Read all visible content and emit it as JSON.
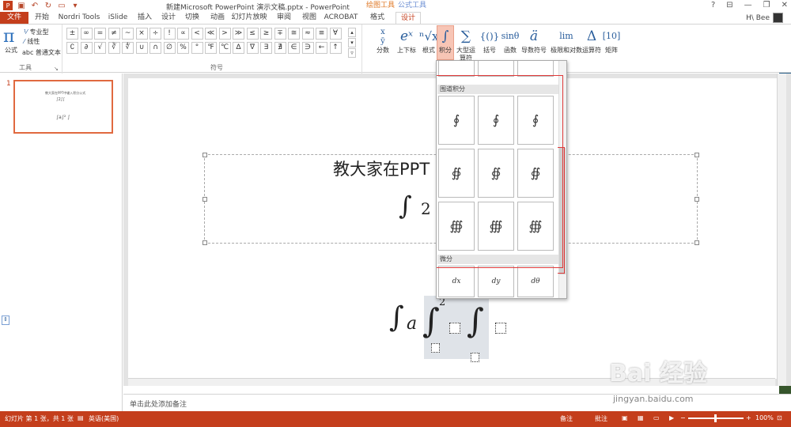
{
  "window": {
    "title": "新建Microsoft PowerPoint 演示文稿.pptx - PowerPoint",
    "context_groups": [
      {
        "label": "绘图工具",
        "color": "#e07b2a"
      },
      {
        "label": "公式工具",
        "color": "#6d8fd3"
      }
    ],
    "controls": [
      "?",
      "⊟",
      "—",
      "❐",
      "✕"
    ],
    "user": "H\\ Bee"
  },
  "tabs": [
    "文件",
    "开始",
    "Nordri Tools",
    "iSlide",
    "插入",
    "设计",
    "切换",
    "动画",
    "幻灯片放映",
    "审阅",
    "视图",
    "ACROBAT",
    "格式",
    "设计"
  ],
  "ribbon": {
    "tools": {
      "formula_label": "公式",
      "professional": "专业型",
      "linear": "线性",
      "plain_text": "abc 普通文本",
      "group_label": "工具"
    },
    "symbols": {
      "row1": [
        "±",
        "∞",
        "=",
        "≠",
        "~",
        "×",
        "÷",
        "!",
        "∝",
        "<",
        "≪",
        ">",
        "≫",
        "≤",
        "≥",
        "∓",
        "≅",
        "≈",
        "≡",
        "∀"
      ],
      "row2": [
        "∁",
        "∂",
        "√",
        "∛",
        "∜",
        "∪",
        "∩",
        "∅",
        "%",
        "°",
        "℉",
        "℃",
        "∆",
        "∇",
        "∃",
        "∄",
        "∈",
        "∋",
        "←",
        "↑"
      ],
      "group_label": "符号"
    },
    "structures": [
      {
        "icon": "x/y",
        "label": "分数"
      },
      {
        "icon": "eˣ",
        "label": "上下标"
      },
      {
        "icon": "ⁿ√x",
        "label": "根式"
      },
      {
        "icon": "∫",
        "label": "积分"
      },
      {
        "icon": "∑",
        "label": "大型运算符"
      },
      {
        "icon": "{()}",
        "label": "括号"
      },
      {
        "icon": "sinθ",
        "label": "函数"
      },
      {
        "icon": "ä",
        "label": "导数符号"
      },
      {
        "icon": "lim",
        "label": "极限和对数"
      },
      {
        "icon": "Δ",
        "label": "运算符"
      },
      {
        "icon": "[10]",
        "label": "矩阵"
      }
    ]
  },
  "slide_pane": {
    "slide_number": "1",
    "thumb_title": "教大家在PPT中输入积分公式",
    "thumb_eq1": "∫2∫∫",
    "thumb_eq2": "∫a∫² ∫"
  },
  "slide": {
    "title": "教大家在PPT",
    "eq1": "∫",
    "eq1_sub": "2",
    "eq2_a": "∫",
    "eq2_b": "a",
    "eq2_c": "∫",
    "eq2_sup": "2",
    "eq2_d": "∫"
  },
  "gallery": {
    "section1": "围道积分",
    "section2": "微分",
    "contour_items": [
      "∮",
      "∮",
      "∮",
      "∯",
      "∯",
      "∯",
      "∰",
      "∰",
      "∰"
    ],
    "diff_items": [
      "dx",
      "dy",
      "dθ"
    ]
  },
  "notes": {
    "placeholder": "单击此处添加备注"
  },
  "status": {
    "slide_info": "幻灯片 第 1 张，共 1 张",
    "language": "英语(美国)",
    "notes_btn": "备注",
    "comments_btn": "批注",
    "zoom": "100%"
  },
  "watermark": {
    "brand": "Bai 经验",
    "url": "jingyan.baidu.com"
  }
}
